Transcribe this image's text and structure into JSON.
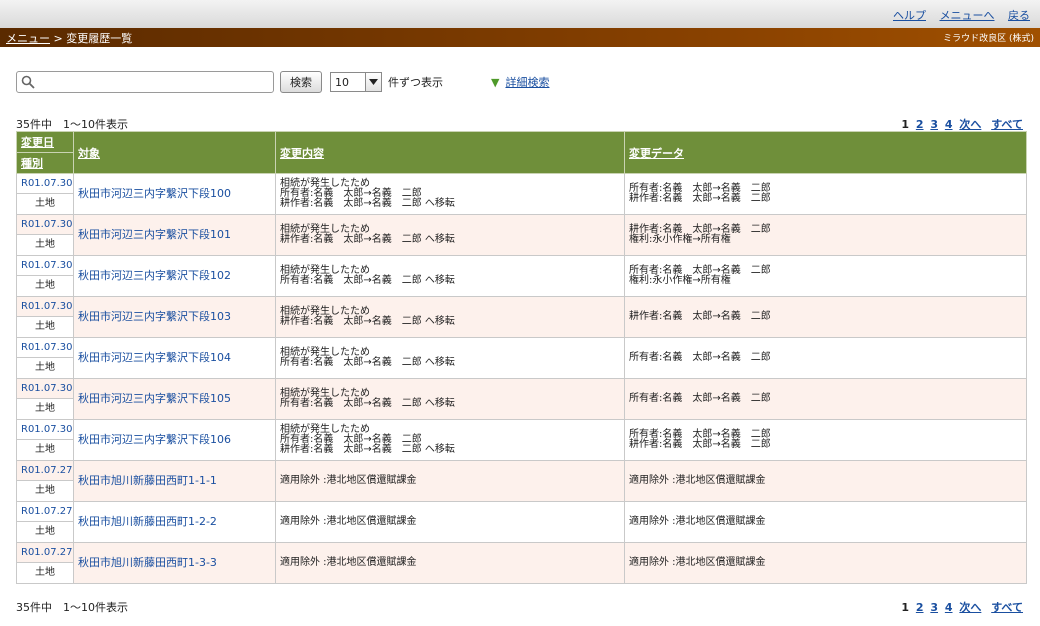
{
  "topnav": {
    "help": "ヘルプ",
    "menu": "メニューへ",
    "back": "戻る"
  },
  "header": {
    "crumb_menu": "メニュー",
    "crumb_sep": " > ",
    "crumb_page": "変更履歴一覧",
    "org": "ミラウド改良区 (株式)"
  },
  "search": {
    "value": "",
    "placeholder": "",
    "button": "検索",
    "per_page": "10",
    "per_page_label": "件ずつ表示",
    "advanced": "詳細検索"
  },
  "count_text": "35件中　1〜10件表示",
  "pager": {
    "current": "1",
    "pages": [
      "2",
      "3",
      "4"
    ],
    "next": "次へ",
    "all": "すべて"
  },
  "columns": {
    "date": "変更日",
    "kind": "種別",
    "target": "対象",
    "content": "変更内容",
    "data": "変更データ"
  },
  "rows": [
    {
      "date": "R01.07.30",
      "kind": "土地",
      "target": "秋田市河辺三内字繋沢下段100",
      "content": [
        "相続が発生したため",
        "所有者:名義　太郎→名義　二郎",
        "耕作者:名義　太郎→名義　二郎 へ移転"
      ],
      "data": [
        "所有者:名義　太郎→名義　二郎",
        "耕作者:名義　太郎→名義　二郎"
      ]
    },
    {
      "date": "R01.07.30",
      "kind": "土地",
      "target": "秋田市河辺三内字繋沢下段101",
      "content": [
        "相続が発生したため",
        "耕作者:名義　太郎→名義　二郎 へ移転"
      ],
      "data": [
        "耕作者:名義　太郎→名義　二郎",
        "権利:永小作権→所有権"
      ]
    },
    {
      "date": "R01.07.30",
      "kind": "土地",
      "target": "秋田市河辺三内字繋沢下段102",
      "content": [
        "相続が発生したため",
        "所有者:名義　太郎→名義　二郎 へ移転"
      ],
      "data": [
        "所有者:名義　太郎→名義　二郎",
        "権利:永小作権→所有権"
      ]
    },
    {
      "date": "R01.07.30",
      "kind": "土地",
      "target": "秋田市河辺三内字繋沢下段103",
      "content": [
        "相続が発生したため",
        "耕作者:名義　太郎→名義　二郎 へ移転"
      ],
      "data": [
        "耕作者:名義　太郎→名義　二郎"
      ]
    },
    {
      "date": "R01.07.30",
      "kind": "土地",
      "target": "秋田市河辺三内字繋沢下段104",
      "content": [
        "相続が発生したため",
        "所有者:名義　太郎→名義　二郎 へ移転"
      ],
      "data": [
        "所有者:名義　太郎→名義　二郎"
      ]
    },
    {
      "date": "R01.07.30",
      "kind": "土地",
      "target": "秋田市河辺三内字繋沢下段105",
      "content": [
        "相続が発生したため",
        "所有者:名義　太郎→名義　二郎 へ移転"
      ],
      "data": [
        "所有者:名義　太郎→名義　二郎"
      ]
    },
    {
      "date": "R01.07.30",
      "kind": "土地",
      "target": "秋田市河辺三内字繋沢下段106",
      "content": [
        "相続が発生したため",
        "所有者:名義　太郎→名義　二郎",
        "耕作者:名義　太郎→名義　二郎 へ移転"
      ],
      "data": [
        "所有者:名義　太郎→名義　二郎",
        "耕作者:名義　太郎→名義　二郎"
      ]
    },
    {
      "date": "R01.07.27",
      "kind": "土地",
      "target": "秋田市旭川新藤田西町1-1-1",
      "content": [
        "適用除外 :港北地区償還賦課金"
      ],
      "data": [
        "適用除外 :港北地区償還賦課金"
      ]
    },
    {
      "date": "R01.07.27",
      "kind": "土地",
      "target": "秋田市旭川新藤田西町1-2-2",
      "content": [
        "適用除外 :港北地区償還賦課金"
      ],
      "data": [
        "適用除外 :港北地区償還賦課金"
      ]
    },
    {
      "date": "R01.07.27",
      "kind": "土地",
      "target": "秋田市旭川新藤田西町1-3-3",
      "content": [
        "適用除外 :港北地区償還賦課金"
      ],
      "data": [
        "適用除外 :港北地区償還賦課金"
      ]
    }
  ]
}
